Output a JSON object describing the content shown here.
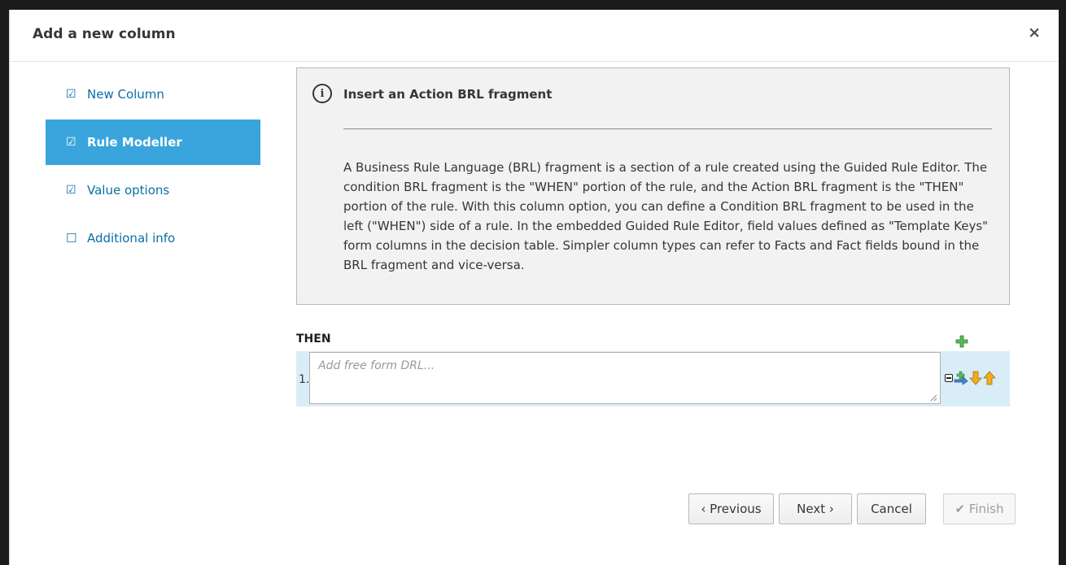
{
  "modal": {
    "title": "Add a new column",
    "close": "×"
  },
  "steps": [
    {
      "label": "New Column",
      "checked": true,
      "active": false
    },
    {
      "label": "Rule Modeller",
      "checked": true,
      "active": true
    },
    {
      "label": "Value options",
      "checked": true,
      "active": false
    },
    {
      "label": "Additional info",
      "checked": false,
      "active": false
    }
  ],
  "info": {
    "icon": "info-circle-icon",
    "title": "Insert an Action BRL fragment",
    "text": "A Business Rule Language (BRL) fragment is a section of a rule created using the Guided Rule Editor. The condition BRL fragment is the \"WHEN\" portion of the rule, and the Action BRL fragment is the \"THEN\" portion of the rule. With this column option, you can define a Condition BRL fragment to be used in the left (\"WHEN\") side of a rule. In the embedded Guided Rule Editor, field values defined as \"Template Keys\" form columns in the decision table. Simpler column types can refer to Facts and Fact fields bound in the BRL fragment and vice-versa."
  },
  "then_section": {
    "label": "THEN",
    "row_number": "1.",
    "drl_value": "",
    "drl_placeholder": "Add free form DRL..."
  },
  "buttons": {
    "previous": "‹ Previous",
    "next": "Next ›",
    "cancel": "Cancel",
    "finish": "✔ Finish"
  },
  "colors": {
    "active_step": "#39a5dc",
    "link": "#0a6ea8",
    "row_highlight": "#d9edf7",
    "add_green": "#5cb85c",
    "arrow_yellow": "#f0ad1e"
  }
}
